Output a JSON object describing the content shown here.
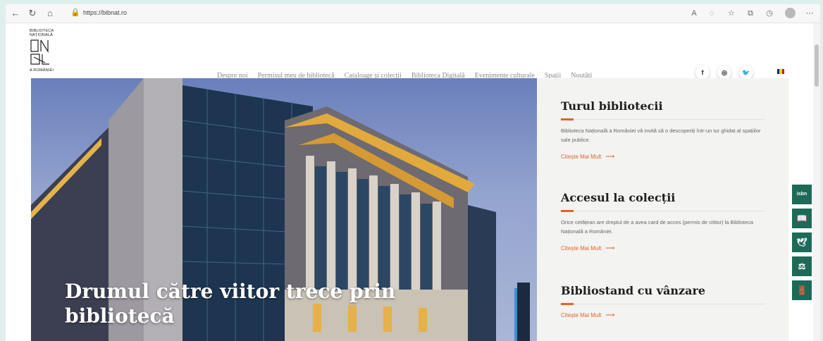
{
  "browser": {
    "url": "https://bibnat.ro"
  },
  "header": {
    "logo_lines": [
      "BIBLIOTECA",
      "NAȚIONALĂ",
      "A ROMÂNIEI"
    ],
    "nav": [
      "Despre noi",
      "Permisul meu de bibliotecă",
      "Cataloage și colecții",
      "Biblioteca Digitală",
      "Evenimente culturale",
      "Spații",
      "Noutăți"
    ],
    "social": [
      "f",
      "◎",
      "🐦"
    ],
    "flag_colors": [
      "#002b7f",
      "#fcd116",
      "#ce1126"
    ]
  },
  "hero": {
    "title": "Drumul către viitor trece prin bibliotecă"
  },
  "panel": {
    "cards": [
      {
        "title": "Turul bibliotecii",
        "text": "Biblioteca Națională a României vă invită să o descoperiți într-un tur ghidat al spațiilor sale publice.",
        "link": "Citește Mai Mult"
      },
      {
        "title": "Accesul la colecții",
        "text": "Orice cetățean are dreptul de a avea card de acces (permis de cititor) la Biblioteca Națională a României.",
        "link": "Citește Mai Mult"
      },
      {
        "title": "Bibliostand cu vânzare",
        "text": "",
        "link": "Citește Mai Mult"
      }
    ]
  },
  "widgets": [
    "isbn",
    "📖",
    "🕊",
    "⚖",
    "🚪"
  ],
  "colors": {
    "accent": "#e3622b",
    "widget": "#1d6a59"
  }
}
